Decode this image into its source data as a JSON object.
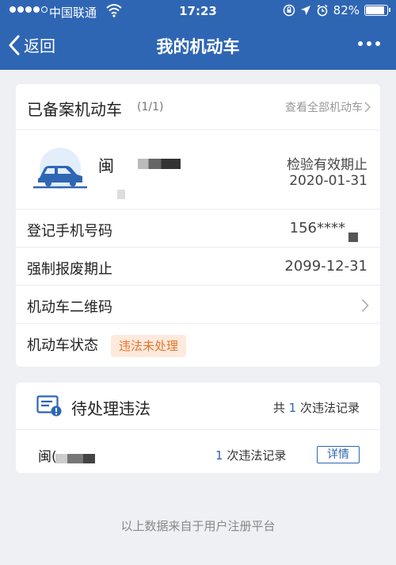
{
  "status_bar": {
    "carrier": "中国联通",
    "time": "17:23",
    "battery": "82%",
    "battery_level": 0.82
  },
  "nav": {
    "back_label": "返回",
    "title": "我的机动车"
  },
  "registered": {
    "title": "已备案机动车",
    "count": "(1/1)",
    "view_all": "查看全部机动车",
    "vehicle": {
      "plate_prefix": "闽",
      "inspection_label": "检验有效期止",
      "inspection_date": "2020-01-31"
    },
    "rows": [
      {
        "label": "登记手机号码",
        "value": "156****"
      },
      {
        "label": "强制报废期止",
        "value": "2099-12-31"
      },
      {
        "label": "机动车二维码"
      },
      {
        "label": "机动车状态",
        "badge": "违法未处理"
      }
    ]
  },
  "violations": {
    "title": "待处理违法",
    "total_prefix": "共 ",
    "total_count": "1",
    "total_suffix": " 次违法记录",
    "record": {
      "plate": "闽(",
      "count": "1",
      "count_suffix": " 次违法记录",
      "detail_button": "详情"
    }
  },
  "footer": "以上数据来自于用户注册平台",
  "colors": {
    "brand": "#2f66b4",
    "badge_text": "#e8742a",
    "badge_bg": "#fdeadd"
  }
}
